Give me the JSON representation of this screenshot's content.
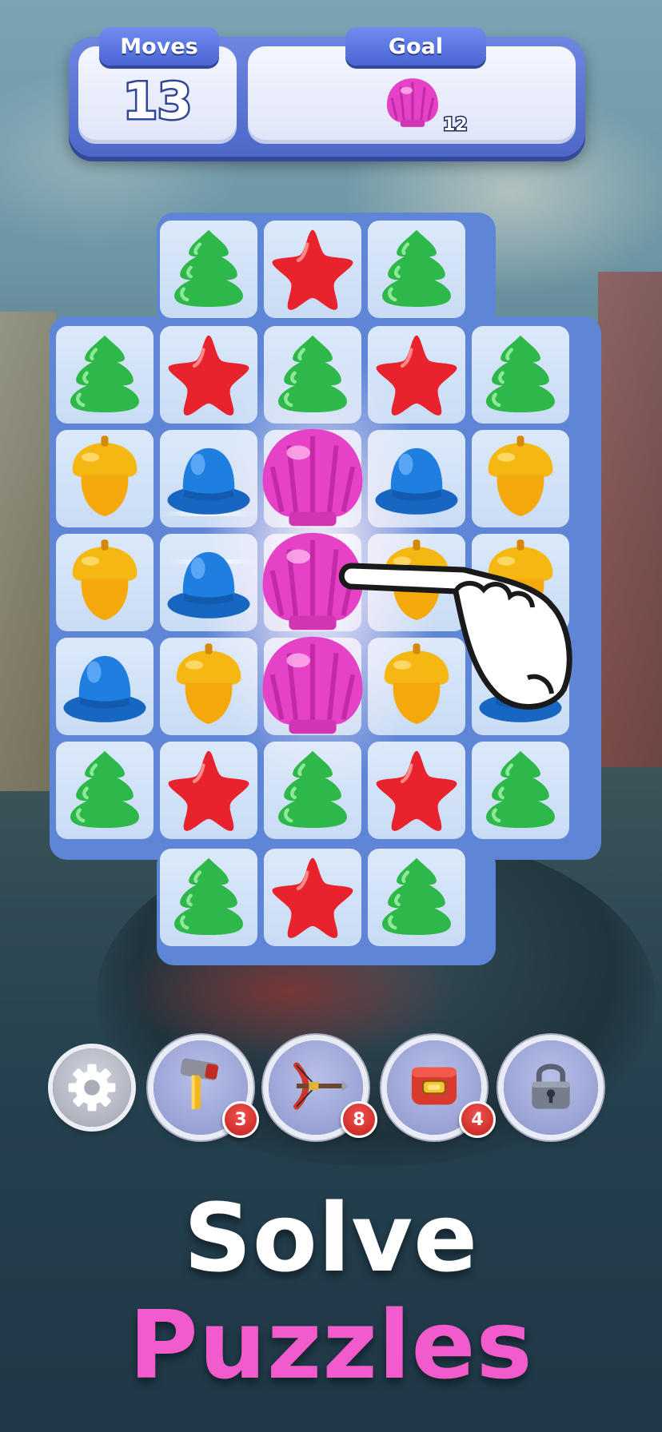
{
  "hud": {
    "moves_label": "Moves",
    "moves_value": "13",
    "goal_label": "Goal",
    "goal_item": "pink-shell-icon",
    "goal_count": "12"
  },
  "boosters": [
    {
      "name": "settings-button",
      "icon": "gear-icon"
    },
    {
      "name": "hammer-booster",
      "icon": "hammer-icon",
      "count": "3"
    },
    {
      "name": "crossbow-booster",
      "icon": "crossbow-icon",
      "count": "8"
    },
    {
      "name": "shuffle-booster",
      "icon": "red-box-icon",
      "count": "4"
    },
    {
      "name": "locked-booster",
      "icon": "padlock-icon"
    }
  ],
  "slogan": {
    "line1": "Solve",
    "line2": "Puzzles"
  },
  "colors": {
    "tree": "#2fb84a",
    "star": "#e8232e",
    "acorn": "#f5b813",
    "hat": "#1f7fe0",
    "shell": "#e542c8",
    "slogan_pink": "#f15bcb"
  }
}
